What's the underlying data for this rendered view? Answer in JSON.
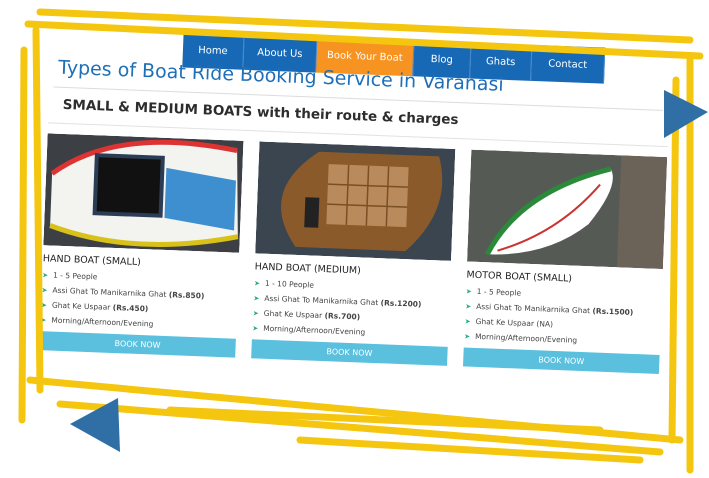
{
  "nav": [
    "Home",
    "About Us",
    "Book Your Boat",
    "Blog",
    "Ghats",
    "Contact"
  ],
  "nav_active": "Book Your Boat",
  "title": "Types of Boat Ride Booking Service in Varanasi",
  "subtitle": "SMALL & MEDIUM BOATS with their route & charges",
  "boats": [
    {
      "name": "HAND BOAT (SMALL)",
      "capacity": "1 - 5 People",
      "route1_label": "Assi Ghat To Manikarnika Ghat",
      "route1_price": "(Rs.850)",
      "route2_label": "Ghat Ke Uspaar",
      "route2_price": "(Rs.450)",
      "timing": "Morning/Afternoon/Evening",
      "button": "BOOK NOW"
    },
    {
      "name": "HAND BOAT (MEDIUM)",
      "capacity": "1 - 10 People",
      "route1_label": "Assi Ghat To Manikarnika Ghat",
      "route1_price": "(Rs.1200)",
      "route2_label": "Ghat Ke Uspaar",
      "route2_price": "(Rs.700)",
      "timing": "Morning/Afternoon/Evening",
      "button": "BOOK NOW"
    },
    {
      "name": "MOTOR BOAT (SMALL)",
      "capacity": "1 - 5 People",
      "route1_label": "Assi Ghat To Manikarnika Ghat",
      "route1_price": "(Rs.1500)",
      "route2_label": "Ghat Ke Uspaar (NA)",
      "route2_price": "",
      "timing": "Morning/Afternoon/Evening",
      "button": "BOOK NOW"
    }
  ],
  "colors": {
    "nav_blue": "#1769b6",
    "nav_active": "#f79320",
    "title_blue": "#1e6fb8",
    "button": "#5bc0de",
    "frame_yellow": "#f5c60f",
    "arrow_blue": "#2f6fa5"
  },
  "icons": {
    "bullet": "arrow-right-icon",
    "slide_next": "triangle-right-icon",
    "slide_prev": "triangle-left-icon"
  }
}
